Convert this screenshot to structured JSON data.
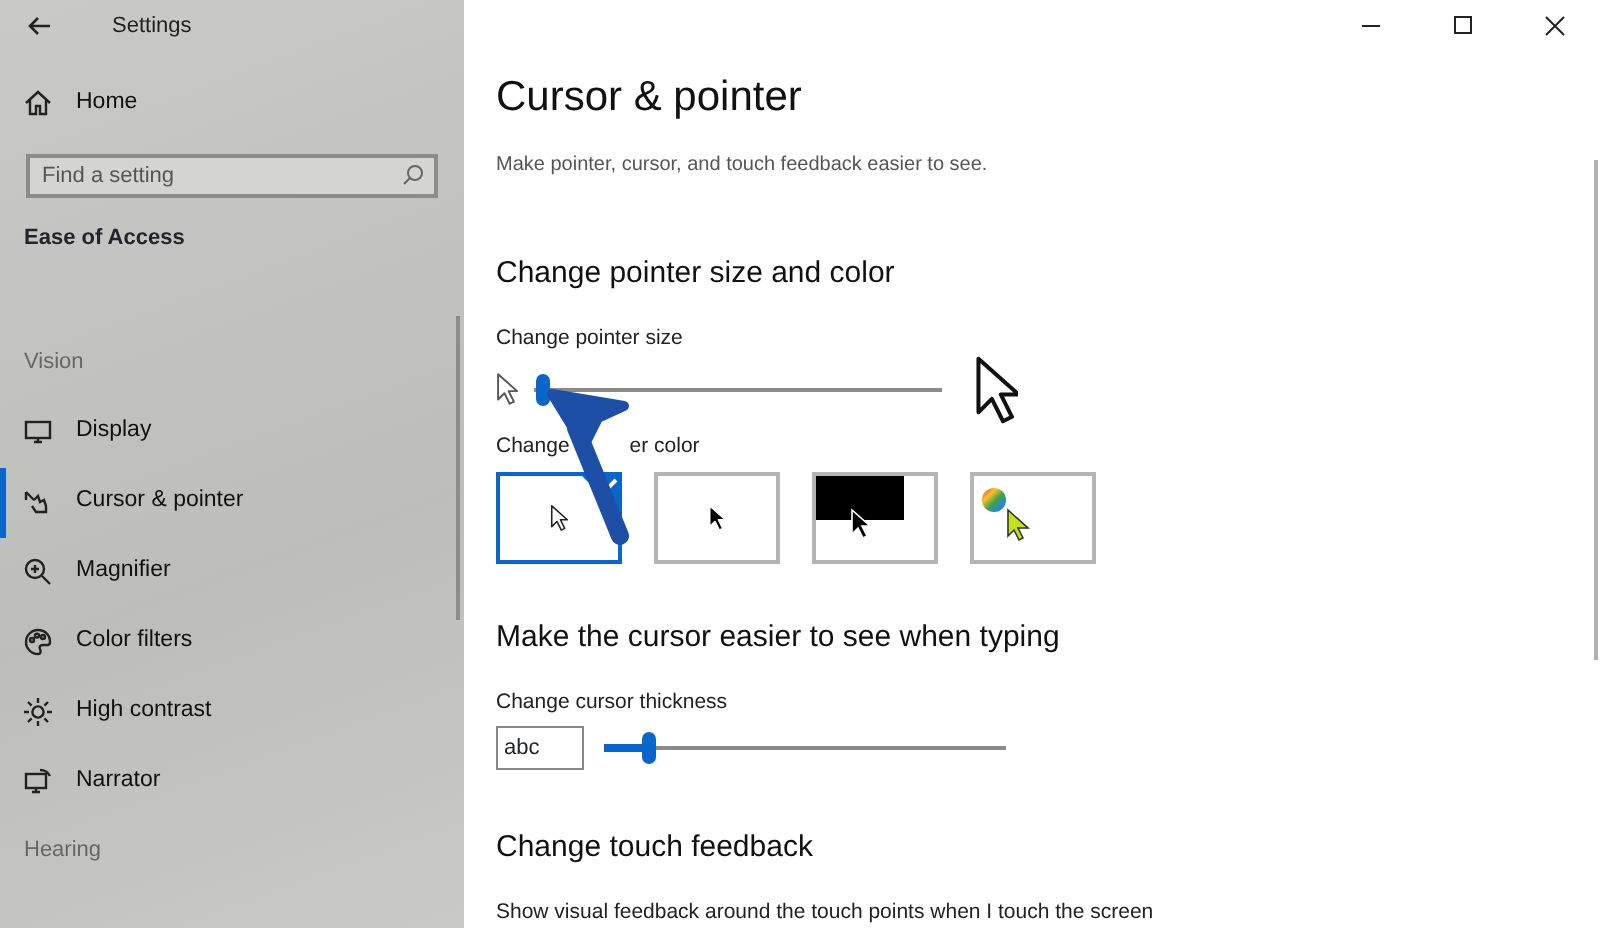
{
  "window": {
    "title": "Settings"
  },
  "sidebar": {
    "home": "Home",
    "search": {
      "placeholder": "Find a setting"
    },
    "category": "Ease of Access",
    "groups": [
      {
        "heading": "Vision",
        "items": [
          {
            "label": "Display",
            "kind": "display",
            "selected": false
          },
          {
            "label": "Cursor & pointer",
            "kind": "cursor",
            "selected": true
          },
          {
            "label": "Magnifier",
            "kind": "magnifier",
            "selected": false
          },
          {
            "label": "Color filters",
            "kind": "palette",
            "selected": false
          },
          {
            "label": "High contrast",
            "kind": "sun",
            "selected": false
          },
          {
            "label": "Narrator",
            "kind": "narrator",
            "selected": false
          }
        ]
      },
      {
        "heading": "Hearing"
      }
    ]
  },
  "page": {
    "title": "Cursor & pointer",
    "description": "Make pointer, cursor, and touch feedback easier to see.",
    "sections": [
      {
        "heading": "Change pointer size and color",
        "size_label": "Change pointer size",
        "size_slider": {
          "level": 0.02
        },
        "color_label": [
          "Change",
          "er color"
        ],
        "colors": [
          {
            "kind": "white",
            "selected": true
          },
          {
            "kind": "black",
            "selected": false
          },
          {
            "kind": "inverted",
            "selected": false
          },
          {
            "kind": "custom",
            "selected": false
          }
        ]
      },
      {
        "heading": "Make the cursor easier to see when typing",
        "thickness_label": "Change cursor thickness",
        "preview": "abc",
        "thickness_slider": {
          "level": 0.11
        }
      },
      {
        "heading": "Change touch feedback",
        "text": "Show visual feedback around the touch points when I touch the screen"
      }
    ]
  }
}
